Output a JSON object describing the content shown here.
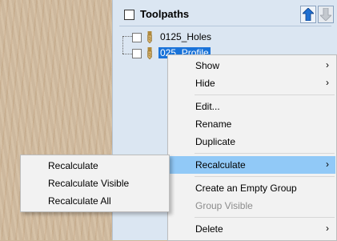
{
  "panel": {
    "title": "Toolpaths",
    "move_up_icon": "arrow-up-icon",
    "move_down_icon": "arrow-down-icon"
  },
  "tree": {
    "items": [
      {
        "label": "0125_Holes",
        "selected": false
      },
      {
        "label": "025_Profile",
        "selected": true
      }
    ]
  },
  "context_menu": {
    "items": [
      {
        "label": "Show",
        "submenu": true
      },
      {
        "label": "Hide",
        "submenu": true
      },
      {
        "label": "Edit..."
      },
      {
        "label": "Rename"
      },
      {
        "label": "Duplicate"
      },
      {
        "label": "Recalculate",
        "submenu": true,
        "highlighted": true
      },
      {
        "label": "Create an Empty Group"
      },
      {
        "label": "Group Visible",
        "disabled": true
      },
      {
        "label": "Delete",
        "submenu": true
      }
    ]
  },
  "submenu": {
    "items": [
      {
        "label": "Recalculate"
      },
      {
        "label": "Recalculate Visible"
      },
      {
        "label": "Recalculate All"
      }
    ]
  },
  "colors": {
    "highlight": "#91c9f7",
    "selection": "#1a73d9",
    "panel_bg": "#dbe6f2"
  }
}
